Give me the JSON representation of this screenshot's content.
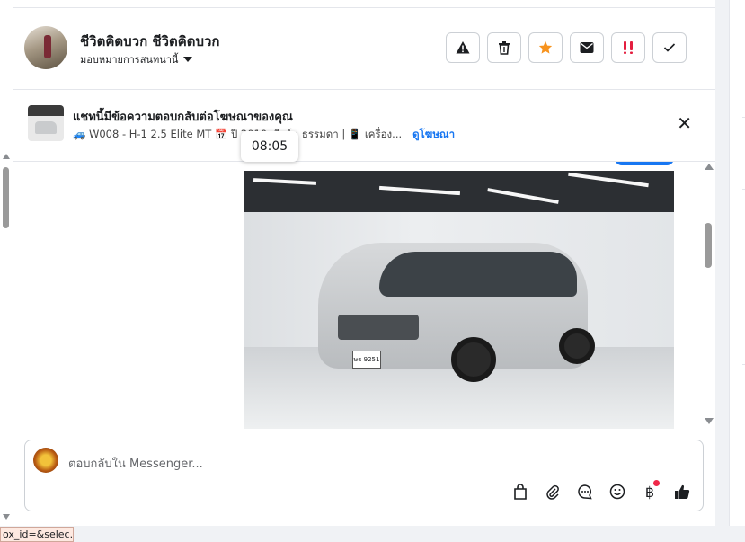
{
  "header": {
    "page_name": "ชีวิตคิดบวก ชีวิตคิดบวก",
    "assign_label": "มอบหมายการสนทนานี้",
    "actions": [
      "warning-icon",
      "trash-icon",
      "star-icon",
      "envelope-icon",
      "urgent-icon",
      "check-icon"
    ],
    "star_color": "#f7931e",
    "urgent_color": "#e41e3f"
  },
  "ad": {
    "title": "แชทนี้มีข้อความตอบกลับต่อโฆษณาของคุณ",
    "detail": "🚙 W008 - H-1 2.5 Elite MT 📅 ปี 2010 เกียร์ : ธรรมดา | 📱 เครื่อง...",
    "link": "ดูโฆษณา"
  },
  "tooltip": {
    "time": "08:05"
  },
  "message": {
    "plate_text": "ษธ 9251"
  },
  "composer": {
    "placeholder": "ตอบกลับใน Messenger...",
    "tools": [
      "shopping-bag-icon",
      "paperclip-icon",
      "saved-replies-icon",
      "emoji-icon",
      "baht-icon",
      "thumbs-up-icon"
    ]
  },
  "status_bar": {
    "url": "ox_id=&selec..."
  },
  "colors": {
    "accent": "#1877f2",
    "notification": "#f02849"
  }
}
